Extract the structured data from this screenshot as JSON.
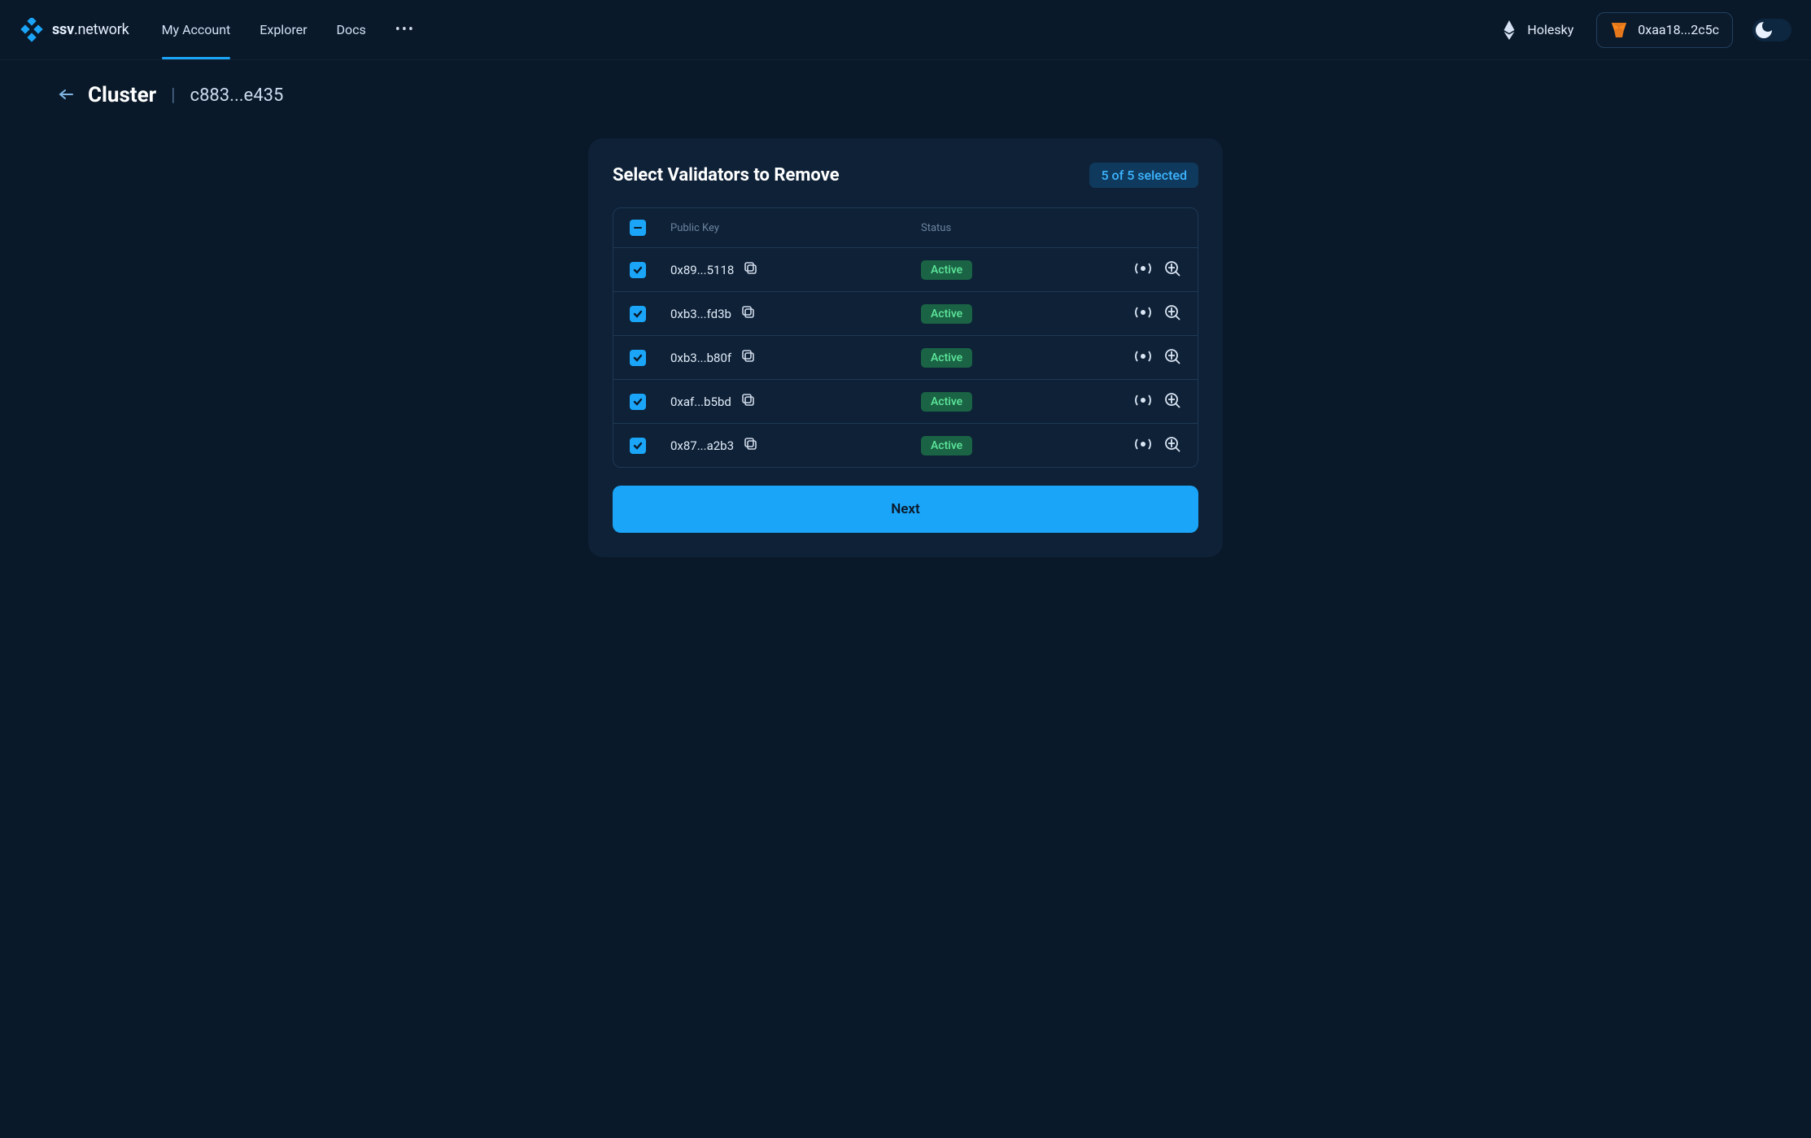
{
  "brand": {
    "name_strong": "ssv",
    "name_light": ".network"
  },
  "nav": {
    "items": [
      {
        "label": "My Account",
        "active": true
      },
      {
        "label": "Explorer",
        "active": false
      },
      {
        "label": "Docs",
        "active": false
      }
    ]
  },
  "header": {
    "network_name": "Holesky",
    "wallet_address": "0xaa18...2c5c"
  },
  "breadcrumb": {
    "title": "Cluster",
    "separator": "|",
    "id": "c883...e435"
  },
  "panel": {
    "title": "Select Validators to Remove",
    "selected_text": "5 of 5 selected",
    "columns": {
      "col1": "Public Key",
      "col2": "Status"
    },
    "rows": [
      {
        "pk": "0x89...5118",
        "status": "Active",
        "checked": true
      },
      {
        "pk": "0xb3...fd3b",
        "status": "Active",
        "checked": true
      },
      {
        "pk": "0xb3...b80f",
        "status": "Active",
        "checked": true
      },
      {
        "pk": "0xaf...b5bd",
        "status": "Active",
        "checked": true
      },
      {
        "pk": "0x87...a2b3",
        "status": "Active",
        "checked": true
      }
    ],
    "next_label": "Next"
  },
  "icons": {
    "copy": "copy-icon",
    "beacon": "beacon-icon",
    "explorer": "explorer-icon"
  },
  "colors": {
    "bg": "#0a1929",
    "panel": "#0e2137",
    "accent": "#1ba5f8",
    "status_bg": "#1a6344",
    "status_fg": "#5ee79b"
  }
}
